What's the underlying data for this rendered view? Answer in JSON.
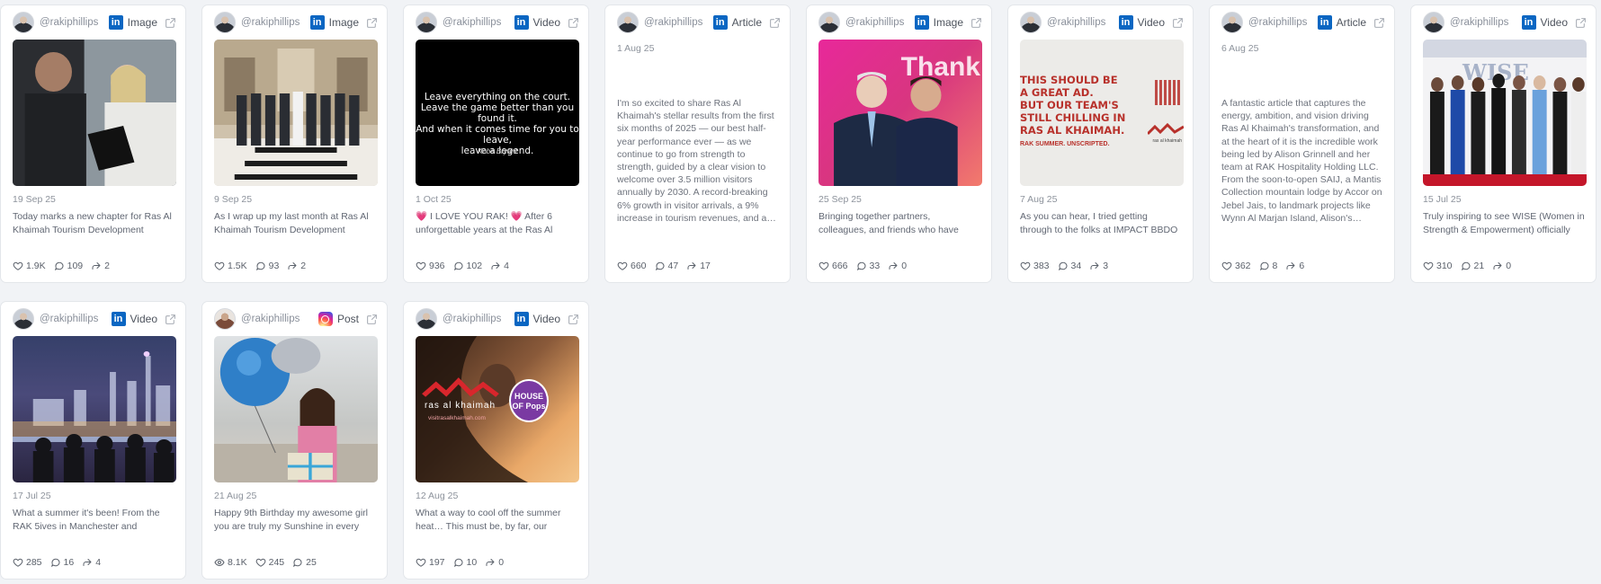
{
  "posts": [
    {
      "handle": "@rakiphillips",
      "platform_icon": "linkedin-icon",
      "type": "Image",
      "date": "19 Sep 25",
      "caption": "Today marks a new chapter for Ras Al Khaimah Tourism Development Authority…",
      "likes": "1.9K",
      "comments": "109",
      "shares": "2"
    },
    {
      "handle": "@rakiphillips",
      "platform_icon": "linkedin-icon",
      "type": "Image",
      "date": "9 Sep 25",
      "caption": "As I wrap up my last month at Ras Al Khaimah Tourism Development Authority…",
      "likes": "1.5K",
      "comments": "93",
      "shares": "2"
    },
    {
      "handle": "@rakiphillips",
      "platform_icon": "linkedin-icon",
      "type": "Video",
      "date": "1 Oct 25",
      "caption": "💗 I LOVE YOU RAK! 💗 After 6 unforgettable years at the Ras Al Khaimah…",
      "likes": "936",
      "comments": "102",
      "shares": "4",
      "media_text": "Leave everything on the court.\nLeave the game better than you found it.\nAnd when it comes time for you to leave,\nleave a legend.",
      "media_sign": "Kobe Bryant"
    },
    {
      "handle": "@rakiphillips",
      "platform_icon": "linkedin-icon",
      "type": "Article",
      "date": "1 Aug 25",
      "caption": "I'm so excited to share Ras Al Khaimah's stellar results from the first six months of 2025 — our best half-year performance ever — as we continue to go from strength to strength, guided by a clear vision to welcome over 3.5 million visitors annually by 2030. A record-breaking 6% growth in visitor arrivals, a 9% increase in tourism revenues, and a…",
      "likes": "660",
      "comments": "47",
      "shares": "17"
    },
    {
      "handle": "@rakiphillips",
      "platform_icon": "linkedin-icon",
      "type": "Image",
      "date": "25 Sep 25",
      "caption": "Bringing together partners, colleagues, and friends who have become like family…",
      "likes": "666",
      "comments": "33",
      "shares": "0",
      "media_text": "Thank"
    },
    {
      "handle": "@rakiphillips",
      "platform_icon": "linkedin-icon",
      "type": "Video",
      "date": "7 Aug 25",
      "caption": "As you can hear, I tried getting through to the folks at IMPACT BBDO but it turns…",
      "likes": "383",
      "comments": "34",
      "shares": "3",
      "media_text": "THIS SHOULD BE\nA GREAT AD.\nBUT OUR TEAM'S\nSTILL CHILLING IN\nRAS AL KHAIMAH.",
      "media_sub": "RAK SUMMER. UNSCRIPTED.",
      "media_logo": "ras al khaimah"
    },
    {
      "handle": "@rakiphillips",
      "platform_icon": "linkedin-icon",
      "type": "Article",
      "date": "6 Aug 25",
      "caption": "A fantastic article that captures the energy, ambition, and vision driving Ras Al Khaimah's transformation, and at the heart of it is the incredible work being led by Alison Grinnell and her team at RAK Hospitality Holding LLC. From the soon-to-open SAIJ, a Mantis Collection mountain lodge by Accor on Jebel Jais, to landmark projects like Wynn Al Marjan Island, Alison's…",
      "likes": "362",
      "comments": "8",
      "shares": "6"
    },
    {
      "handle": "@rakiphillips",
      "platform_icon": "linkedin-icon",
      "type": "Video",
      "date": "15 Jul 25",
      "caption": "Truly inspiring to see WISE (Women in Strength & Empowerment) officially launch…",
      "likes": "310",
      "comments": "21",
      "shares": "0",
      "media_text": "WISE"
    },
    {
      "handle": "@rakiphillips",
      "platform_icon": "linkedin-icon",
      "type": "Video",
      "date": "17 Jul 25",
      "caption": "What a summer it's been! From the RAK 5ives in Manchester and London…",
      "likes": "285",
      "comments": "16",
      "shares": "4"
    },
    {
      "handle": "@rakiphillips",
      "platform_icon": "instagram-icon",
      "type": "Post",
      "date": "21 Aug 25",
      "caption": "Happy 9th Birthday my awesome girl you are truly my Sunshine in every way…",
      "views": "8.1K",
      "likes": "245",
      "comments": "25"
    },
    {
      "handle": "@rakiphillips",
      "platform_icon": "linkedin-icon",
      "type": "Video",
      "date": "12 Aug 25",
      "caption": "What a way to cool off the summer heat… This must be, by far, our juiciest…",
      "likes": "197",
      "comments": "10",
      "shares": "0",
      "media_logo": "ras al khaimah",
      "media_url": "visitrasalkhaimah.com",
      "media_badge": "HOUSE OF Pops"
    }
  ],
  "colors": {
    "linkedin": "#0a66c2",
    "background": "#f1f3f6",
    "card": "#ffffff"
  }
}
